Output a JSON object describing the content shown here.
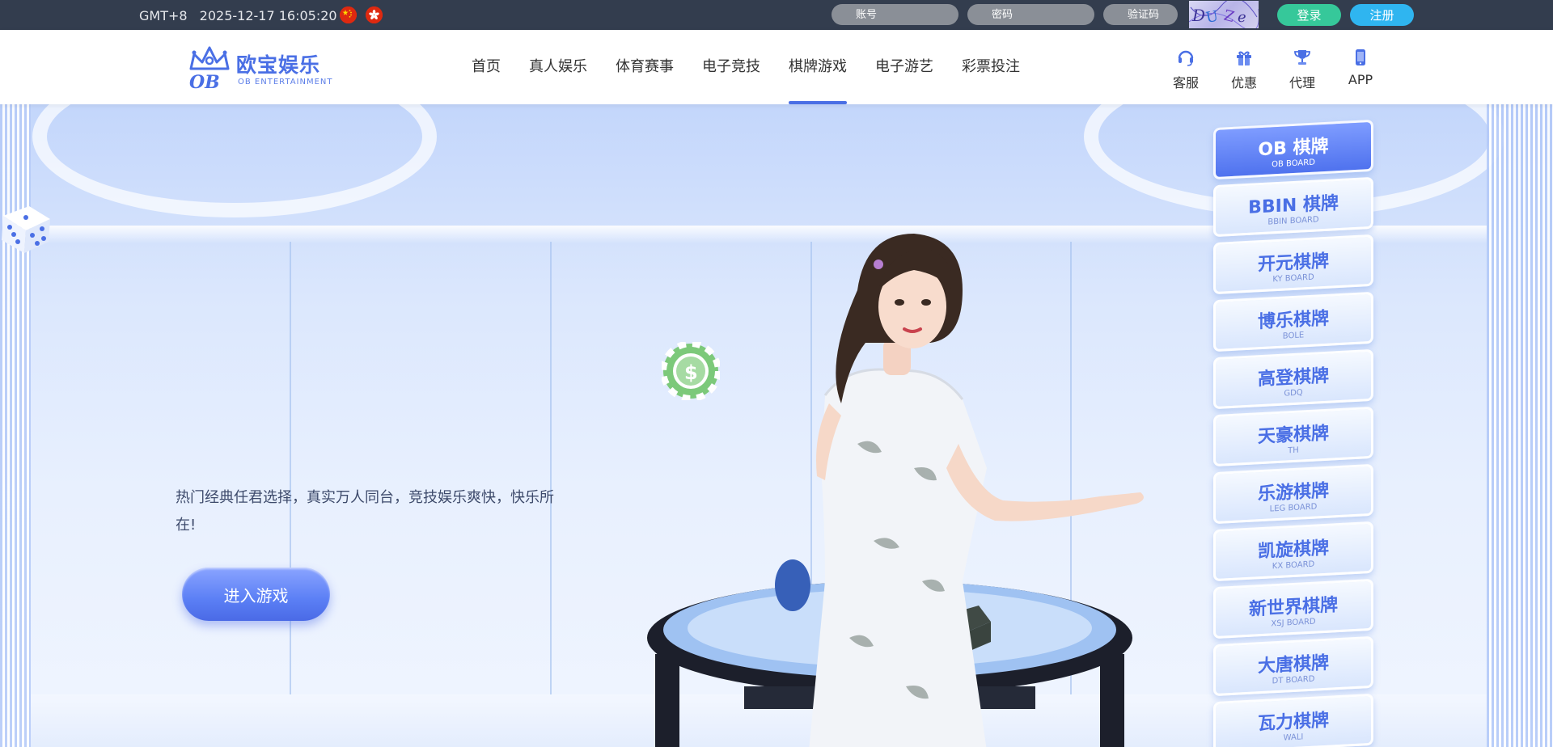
{
  "topbar": {
    "timezone": "GMT+8",
    "datetime": "2025-12-17 16:05:20",
    "account_placeholder": "账号",
    "password_placeholder": "密码",
    "captcha_placeholder": "验证码",
    "login_label": "登录",
    "register_label": "注册",
    "colors": {
      "bg": "#333d4e",
      "login": "#36c89a",
      "register": "#2fb5f0"
    }
  },
  "header": {
    "logo": {
      "cn": "欧宝娱乐",
      "en": "OB ENTERTAINMENT",
      "mark": "OB"
    },
    "nav": [
      "首页",
      "真人娱乐",
      "体育赛事",
      "电子竞技",
      "棋牌游戏",
      "电子游艺",
      "彩票投注"
    ],
    "nav_active": "棋牌游戏",
    "icons": [
      {
        "icon": "headset-icon",
        "label": "客服"
      },
      {
        "icon": "gift-icon",
        "label": "优惠"
      },
      {
        "icon": "trophy-icon",
        "label": "代理"
      },
      {
        "icon": "phone-icon",
        "label": "APP"
      }
    ],
    "accent": "#4a6fe5"
  },
  "banner": {
    "description": "热门经典任君选择，真实万人同台，竞技娱乐爽快，快乐所在!",
    "enter_label": "进入游戏"
  },
  "game_menu": [
    {
      "cn": "OB 棋牌",
      "en": "OB BOARD",
      "active": true
    },
    {
      "cn": "BBIN 棋牌",
      "en": "BBIN BOARD",
      "active": false
    },
    {
      "cn": "开元棋牌",
      "en": "KY BOARD",
      "active": false
    },
    {
      "cn": "博乐棋牌",
      "en": "BOLE",
      "active": false
    },
    {
      "cn": "高登棋牌",
      "en": "GDQ",
      "active": false
    },
    {
      "cn": "天豪棋牌",
      "en": "TH",
      "active": false
    },
    {
      "cn": "乐游棋牌",
      "en": "LEG BOARD",
      "active": false
    },
    {
      "cn": "凯旋棋牌",
      "en": "KX BOARD",
      "active": false
    },
    {
      "cn": "新世界棋牌",
      "en": "XSJ BOARD",
      "active": false
    },
    {
      "cn": "大唐棋牌",
      "en": "DT BOARD",
      "active": false
    },
    {
      "cn": "瓦力棋牌",
      "en": "WALI",
      "active": false
    }
  ]
}
